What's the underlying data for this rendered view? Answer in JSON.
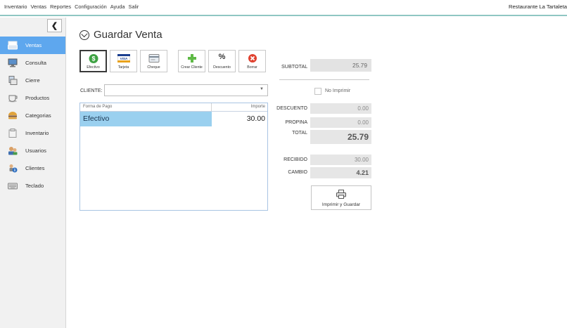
{
  "menu": {
    "items": [
      "Inventario",
      "Ventas",
      "Reportes",
      "Configuración",
      "Ayuda",
      "Salir"
    ],
    "restaurant": "Restaurante La Tartaleta"
  },
  "sidebar": {
    "collapse_glyph": "❮",
    "items": [
      {
        "label": "Ventas",
        "icon": "cash-register-icon",
        "active": true
      },
      {
        "label": "Consulta",
        "icon": "monitor-icon"
      },
      {
        "label": "Cierre",
        "icon": "register-close-icon"
      },
      {
        "label": "Productos",
        "icon": "coffee-cup-icon"
      },
      {
        "label": "Categorias",
        "icon": "burger-icon"
      },
      {
        "label": "Inventario",
        "icon": "box-icon"
      },
      {
        "label": "Usuarios",
        "icon": "users-icon"
      },
      {
        "label": "Clientes",
        "icon": "client-info-icon"
      },
      {
        "label": "Teclado",
        "icon": "keyboard-icon"
      }
    ]
  },
  "page": {
    "title": "Guardar Venta"
  },
  "toolbar": {
    "efectivo": "Efectivo",
    "tarjeta": "Tarjeta",
    "cheque": "Cheque",
    "crear_cliente": "Crear Cliente",
    "descuento": "Descuento",
    "borrar": "Borrar",
    "visa_text": "VISA",
    "percent_text": "%"
  },
  "form": {
    "cliente_label": "CLIENTE:",
    "cliente_value": "",
    "no_imprimir_label": "No Imprimir",
    "no_imprimir_checked": false
  },
  "payments": {
    "columns": [
      "Forma de Pago",
      "Importe"
    ],
    "rows": [
      {
        "forma": "Efectivo",
        "importe": "30.00"
      }
    ]
  },
  "summary": {
    "subtotal_label": "SUBTOTAL",
    "subtotal": "25.79",
    "descuento_label": "DESCUENTO",
    "descuento": "0.00",
    "propina_label": "PROPINA",
    "propina": "0.00",
    "total_label": "TOTAL",
    "total": "25.79",
    "recibido_label": "RECIBIDO",
    "recibido": "30.00",
    "cambio_label": "CAMBIO",
    "cambio": "4.21"
  },
  "print_button": {
    "label": "Imprimir y Guardar"
  },
  "colors": {
    "accent": "#5ea7ee",
    "selected_row": "#9ad0ef",
    "menu_border": "#8fc7c3"
  }
}
